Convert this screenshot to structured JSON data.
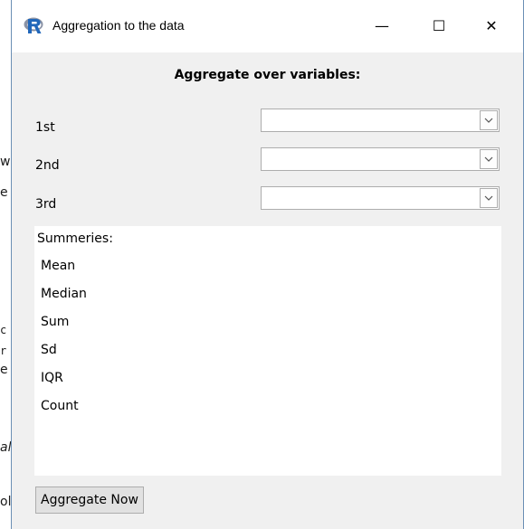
{
  "background_fragments": [
    "w",
    "e",
    "c",
    "r",
    "e",
    "al",
    "ole"
  ],
  "window": {
    "title": "Aggregation to the data",
    "app_icon": "r-logo-icon",
    "controls": {
      "minimize": "—",
      "maximize": "☐",
      "close": "✕"
    }
  },
  "form": {
    "heading": "Aggregate over variables:",
    "rows": [
      {
        "label": "1st",
        "value": ""
      },
      {
        "label": "2nd",
        "value": ""
      },
      {
        "label": "3rd",
        "value": ""
      }
    ],
    "summaries": {
      "header": "Summeries:",
      "items": [
        "Mean",
        "Median",
        "Sum",
        "Sd",
        "IQR",
        "Count"
      ]
    },
    "submit_label": "Aggregate Now"
  }
}
